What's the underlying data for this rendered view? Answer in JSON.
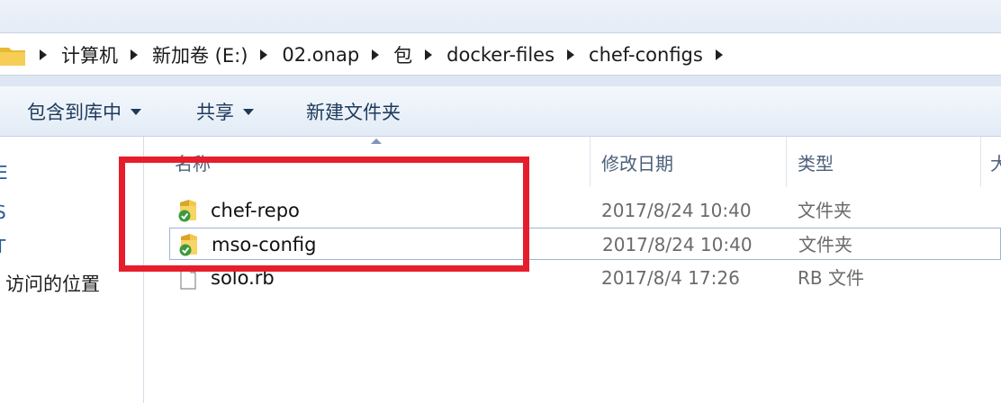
{
  "breadcrumb": [
    "计算机",
    "新加卷 (E:)",
    "02.onap",
    "包",
    "docker-files",
    "chef-configs"
  ],
  "toolbar": {
    "include_library": "包含到库中",
    "share": "共享",
    "new_folder": "新建文件夹"
  },
  "nav": {
    "stubs": [
      "E",
      "S",
      "T"
    ],
    "recent_places": "访问的位置"
  },
  "columns": {
    "name": "名称",
    "date_modified": "修改日期",
    "type": "类型",
    "size": "大"
  },
  "files": [
    {
      "name": "chef-repo",
      "date": "2017/8/24 10:40",
      "type": "文件夹",
      "icon": "folder-synced-icon"
    },
    {
      "name": "mso-config",
      "date": "2017/8/24 10:40",
      "type": "文件夹",
      "icon": "folder-synced-icon"
    },
    {
      "name": "solo.rb",
      "date": "2017/8/4 17:26",
      "type": "RB 文件",
      "icon": "file-icon"
    }
  ],
  "colors": {
    "highlight": "#e61e2b",
    "folder": "#e9b832",
    "check": "#3c9a3c"
  }
}
